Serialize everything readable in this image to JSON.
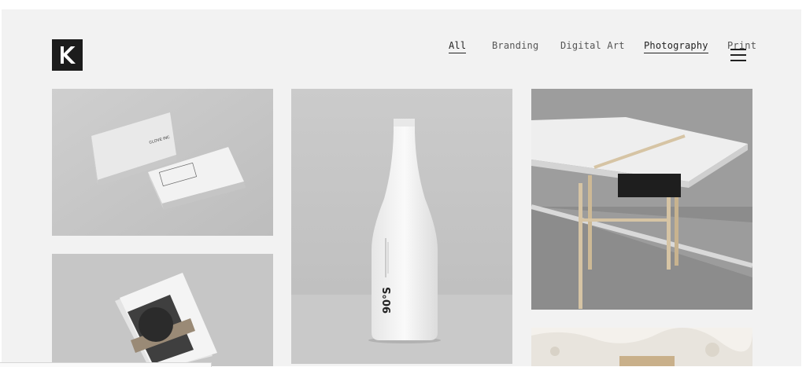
{
  "logo": {
    "letter": "K"
  },
  "nav": {
    "items": [
      {
        "label": "All"
      },
      {
        "label": "Branding"
      },
      {
        "label": "Digital Art"
      },
      {
        "label": "Photography"
      },
      {
        "label": "Print"
      }
    ]
  },
  "portfolio": {
    "cards_text": "CLOVE INC",
    "bottle_text": "90°S"
  },
  "colors": {
    "background": "#f2f2f2",
    "text": "#222222"
  }
}
